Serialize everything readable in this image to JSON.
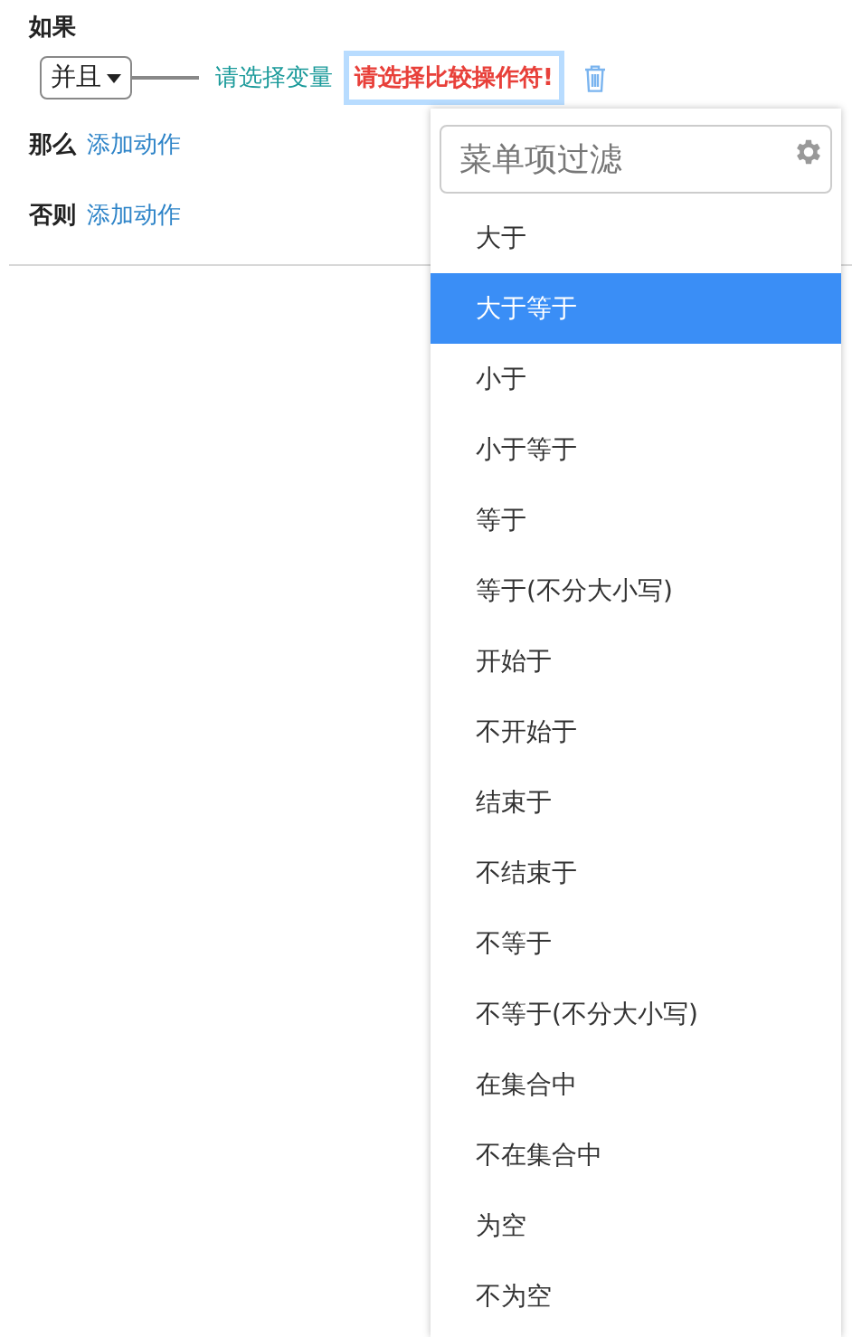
{
  "condition": {
    "label": "如果",
    "join": {
      "label": "并且"
    },
    "variable": "请选择变量",
    "operator": "请选择比较操作符!"
  },
  "then": {
    "label": "那么",
    "action": "添加动作"
  },
  "else": {
    "label": "否则",
    "action": "添加动作"
  },
  "menu": {
    "filter": {
      "placeholder": "菜单项过滤"
    },
    "items": [
      {
        "label": "大于",
        "selected": false
      },
      {
        "label": "大于等于",
        "selected": true
      },
      {
        "label": "小于",
        "selected": false
      },
      {
        "label": "小于等于",
        "selected": false
      },
      {
        "label": "等于",
        "selected": false
      },
      {
        "label": "等于(不分大小写)",
        "selected": false
      },
      {
        "label": "开始于",
        "selected": false
      },
      {
        "label": "不开始于",
        "selected": false
      },
      {
        "label": "结束于",
        "selected": false
      },
      {
        "label": "不结束于",
        "selected": false
      },
      {
        "label": "不等于",
        "selected": false
      },
      {
        "label": "不等于(不分大小写)",
        "selected": false
      },
      {
        "label": "在集合中",
        "selected": false
      },
      {
        "label": "不在集合中",
        "selected": false
      },
      {
        "label": "为空",
        "selected": false
      },
      {
        "label": "不为空",
        "selected": false
      }
    ]
  }
}
